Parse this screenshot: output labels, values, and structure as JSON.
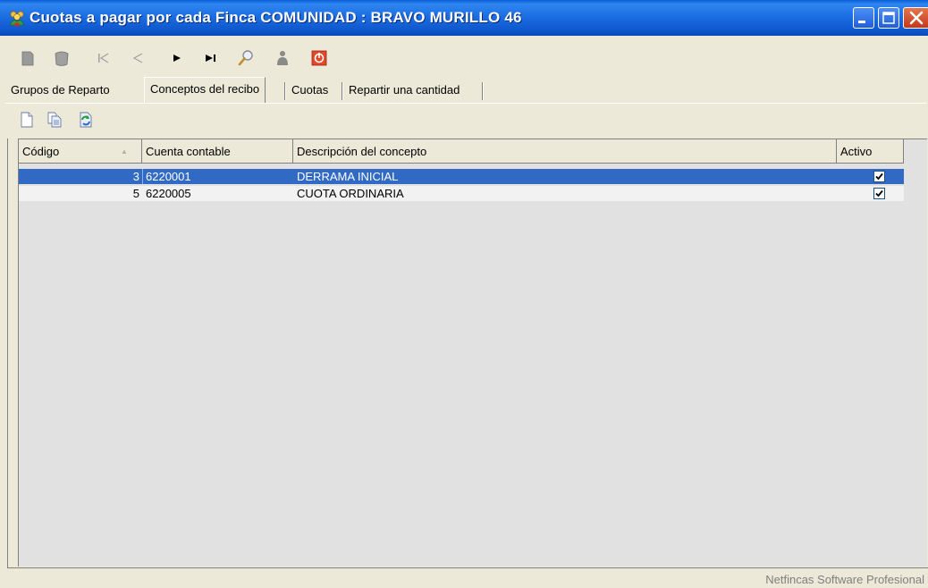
{
  "window": {
    "title": "Cuotas a pagar por cada Finca COMUNIDAD : BRAVO MURILLO 46",
    "controls": [
      "minimize-button",
      "maximize-button",
      "close-button"
    ]
  },
  "toolbar": {
    "icons": [
      "new-doc-icon",
      "edit-icon",
      "first-record-icon",
      "previous-record-icon",
      "next-record-icon",
      "last-record-icon",
      "search-icon",
      "users-icon",
      "exit-icon"
    ]
  },
  "tabs": [
    {
      "label": "Grupos de Reparto",
      "active": false
    },
    {
      "label": "Conceptos del recibo",
      "active": true
    },
    {
      "label": "Cuotas",
      "active": false
    },
    {
      "label": "Repartir una cantidad",
      "active": false
    }
  ],
  "subtoolbar": {
    "icons": [
      "new-icon",
      "copy-icon",
      "refresh-icon"
    ]
  },
  "grid": {
    "columns": [
      "Código",
      "Cuenta contable",
      "Descripción del concepto",
      "Activo"
    ],
    "sort_indicator": "▲",
    "rows": [
      {
        "code": "3",
        "account": "6220001",
        "description": "DERRAMA INICIAL",
        "active": true,
        "selected": true
      },
      {
        "code": "5",
        "account": "6220005",
        "description": "CUOTA ORDINARIA",
        "active": true,
        "selected": false
      }
    ]
  },
  "status": {
    "text": "Netfincas Software Profesional"
  },
  "colors": {
    "titlebar": "#0f56cc",
    "selection": "#316ac5",
    "chrome": "#ece9d8"
  }
}
